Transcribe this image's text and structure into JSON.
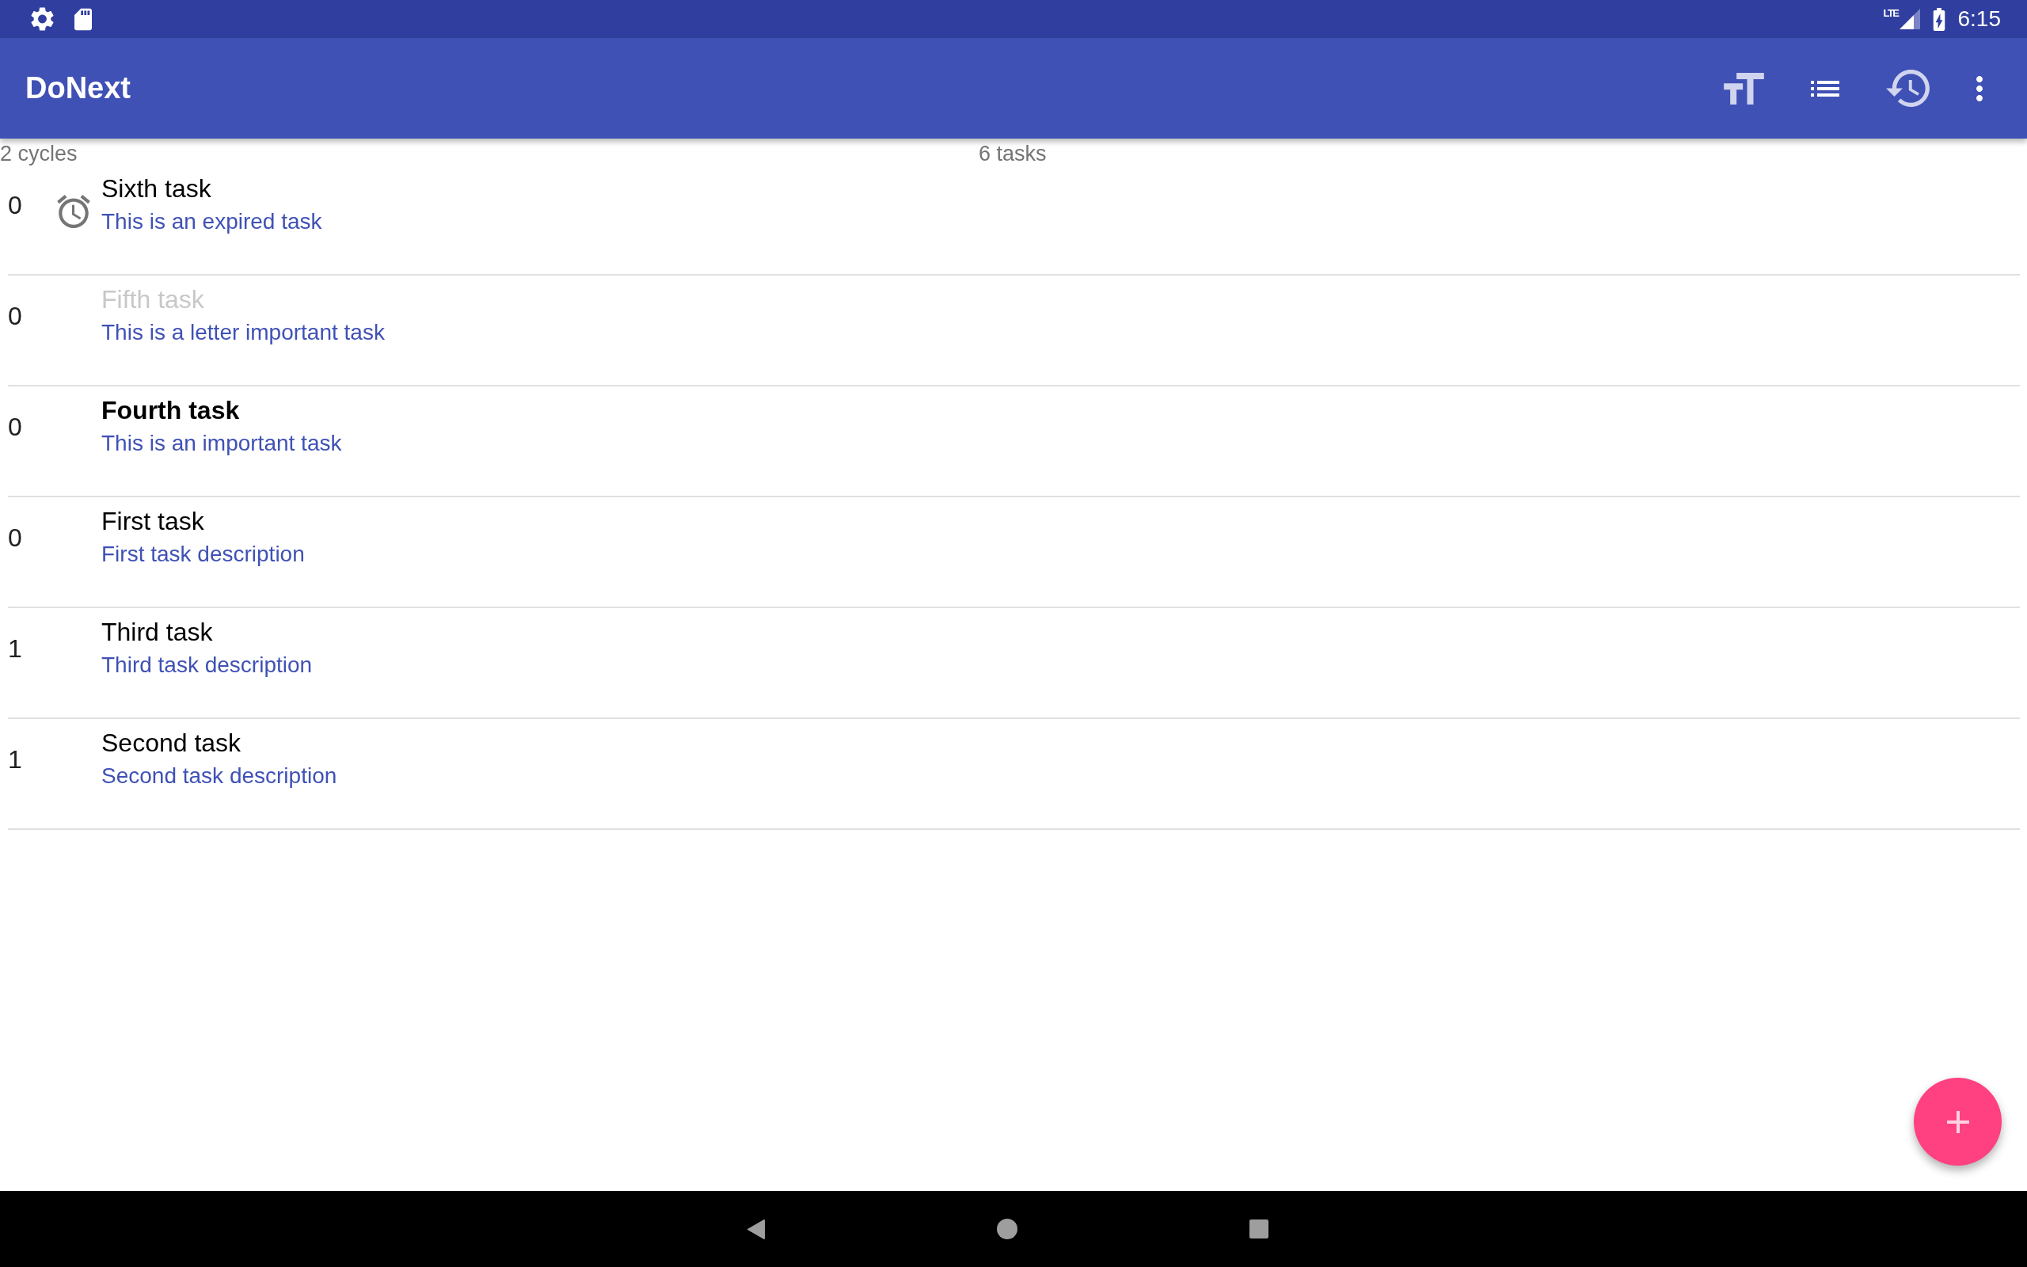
{
  "status_bar": {
    "network": "LTE",
    "time": "6:15"
  },
  "app_bar": {
    "title": "DoNext"
  },
  "summary": {
    "cycles": "2 cycles",
    "tasks": "6 tasks"
  },
  "tasks": [
    {
      "count": "0",
      "title": "Sixth task",
      "description": "This is an expired task",
      "expired": true,
      "faded": false,
      "important": false
    },
    {
      "count": "0",
      "title": "Fifth task",
      "description": "This is a letter important task",
      "expired": false,
      "faded": true,
      "important": false
    },
    {
      "count": "0",
      "title": "Fourth task",
      "description": "This is an important task",
      "expired": false,
      "faded": false,
      "important": true
    },
    {
      "count": "0",
      "title": "First task",
      "description": "First task description",
      "expired": false,
      "faded": false,
      "important": false
    },
    {
      "count": "1",
      "title": "Third task",
      "description": "Third task description",
      "expired": false,
      "faded": false,
      "important": false
    },
    {
      "count": "1",
      "title": "Second task",
      "description": "Second task description",
      "expired": false,
      "faded": false,
      "important": false
    }
  ]
}
